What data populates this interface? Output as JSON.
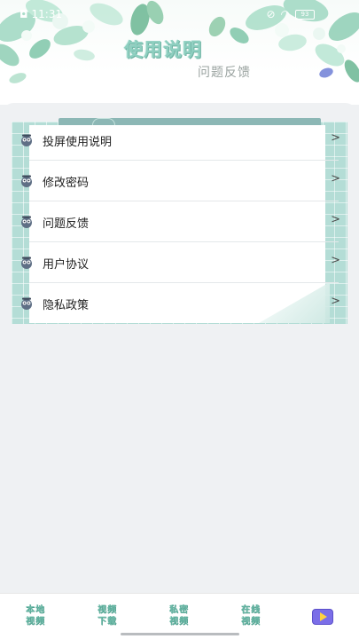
{
  "status_bar": {
    "time": "11:31",
    "battery": "93"
  },
  "header": {
    "title": "使用说明",
    "subtitle": "问题反馈"
  },
  "menu": {
    "items": [
      {
        "label": "投屏使用说明",
        "icon": "owl-icon",
        "chevron": ">"
      },
      {
        "label": "修改密码",
        "icon": "owl-icon",
        "chevron": ">"
      },
      {
        "label": "问题反馈",
        "icon": "owl-icon",
        "chevron": ">"
      },
      {
        "label": "用户协议",
        "icon": "owl-icon",
        "chevron": ">"
      },
      {
        "label": "隐私政策",
        "icon": "owl-icon",
        "chevron": ">"
      }
    ]
  },
  "bottom_nav": {
    "items": [
      {
        "line1": "本地",
        "line2": "视频"
      },
      {
        "line1": "视频",
        "line2": "下载"
      },
      {
        "line1": "私密",
        "line2": "视频"
      },
      {
        "line1": "在线",
        "line2": "视频"
      }
    ],
    "active_icon": "play-icon"
  },
  "colors": {
    "accent_green": "#8ecfc0",
    "grid_teal": "#b4ddd6",
    "play_purple": "#7b6ee8"
  }
}
